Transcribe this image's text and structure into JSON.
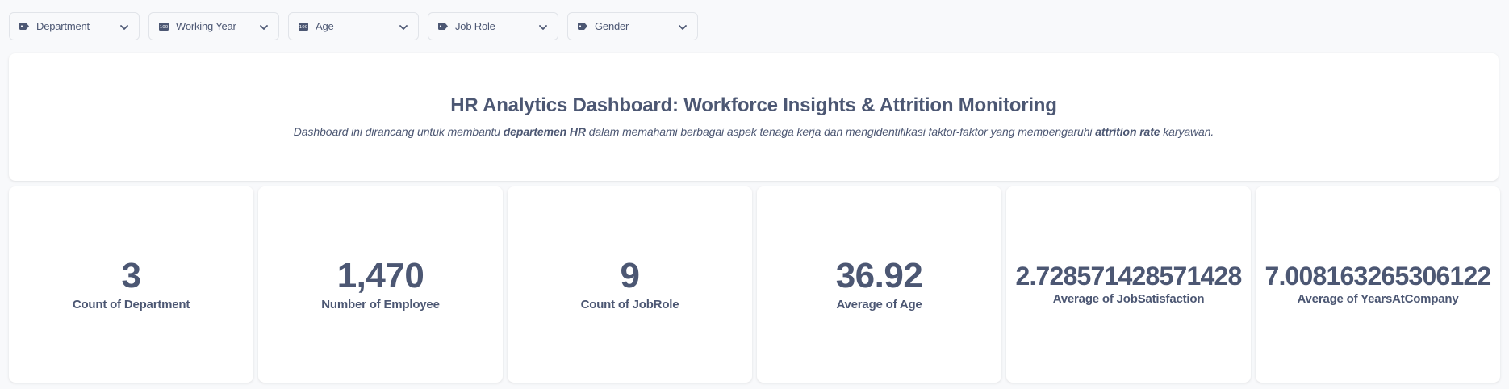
{
  "filters": [
    {
      "label": "Department",
      "icon": "tag-icon"
    },
    {
      "label": "Working Year",
      "icon": "number-icon"
    },
    {
      "label": "Age",
      "icon": "number-icon"
    },
    {
      "label": "Job Role",
      "icon": "tag-icon"
    },
    {
      "label": "Gender",
      "icon": "tag-icon"
    }
  ],
  "hero": {
    "title": "HR Analytics Dashboard: Workforce Insights & Attrition Monitoring",
    "desc_part1": "Dashboard ini dirancang untuk membantu ",
    "desc_bold1": "departemen HR",
    "desc_part2": " dalam memahami berbagai aspek tenaga kerja dan mengidentifikasi faktor-faktor yang mempengaruhi ",
    "desc_bold2": "attrition rate",
    "desc_part3": " karyawan."
  },
  "cards": [
    {
      "value": "3",
      "label": "Count of Department"
    },
    {
      "value": "1,470",
      "label": "Number of Employee"
    },
    {
      "value": "9",
      "label": "Count of JobRole"
    },
    {
      "value": "36.92",
      "label": "Average of Age"
    },
    {
      "value": "2.728571428571428",
      "label": "Average of JobSatisfaction"
    },
    {
      "value": "7.008163265306122",
      "label": "Average of YearsAtCompany"
    }
  ],
  "colors": {
    "text": "#4c5773",
    "background": "#f8f9fb",
    "card": "#ffffff"
  }
}
